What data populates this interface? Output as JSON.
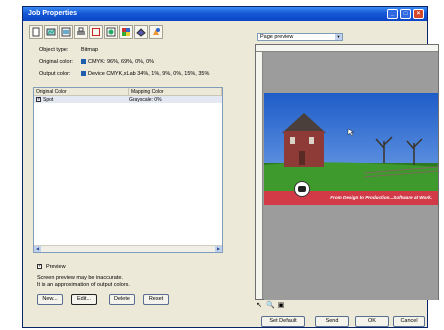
{
  "window": {
    "title": "Job Properties"
  },
  "tabs": [
    {
      "icon": "page-icon"
    },
    {
      "icon": "image-icon"
    },
    {
      "icon": "layout-icon"
    },
    {
      "icon": "printer-icon"
    },
    {
      "icon": "frame-icon"
    },
    {
      "icon": "color-icon"
    },
    {
      "icon": "palette-icon"
    },
    {
      "icon": "ink-icon"
    },
    {
      "icon": "color-map-icon"
    }
  ],
  "object": {
    "type_label": "Object type:",
    "type_value": "Bitmap",
    "original_label": "Original color:",
    "original_value": "CMYK: 96%, 69%, 0%, 0%",
    "output_label": "Output color:",
    "output_value": "Device CMYK,xLab 34%, 1%, 9%, 0%, 15%, 35%"
  },
  "list": {
    "columns": [
      "Original Color",
      "Mapping Color"
    ],
    "rows": [
      {
        "original": "Spot",
        "mapping": "Grayscale: 0%",
        "checked": true
      }
    ]
  },
  "preview": {
    "checkbox_label": "Preview",
    "warning_line1": "Screen preview may be inaccurate.",
    "warning_line2": "It is an approximation of output colors."
  },
  "buttons": {
    "new": "New...",
    "edit": "Edit...",
    "delete": "Delete",
    "reset": "Reset",
    "set_default": "Set Default",
    "send": "Send",
    "ok": "OK",
    "cancel": "Cancel"
  },
  "view": {
    "mode": "Page preview"
  },
  "banner_text": "From Design to Production...Software at Work.",
  "colors": {
    "swatch": "#1f5fae",
    "banner": "#d33a48",
    "titlebar": "#1557d6"
  }
}
